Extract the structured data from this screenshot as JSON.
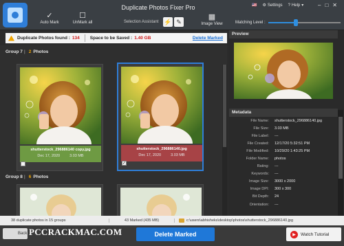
{
  "app": {
    "title": "Duplicate Photos Fixer Pro"
  },
  "toolbar": {
    "auto_mark": "Auto Mark",
    "unmark_all": "UnMark all",
    "selection_assistant": "Selection Assistant",
    "image_view": "Image View",
    "matching_level": "Matching Level :",
    "matching_value": 0.38
  },
  "top_links": {
    "flag": "🇺🇸",
    "settings": "Settings",
    "help": "Help"
  },
  "window_controls": {
    "minimize": "–",
    "maximize": "□",
    "close": "✕"
  },
  "banner": {
    "found_label": "Duplicate Photos found :",
    "found_value": "134",
    "saved_label": "Space to be Saved :",
    "saved_value": "1.40 GB",
    "delete_link": "Delete Marked"
  },
  "groups": [
    {
      "label": "Group 7",
      "count": "2",
      "suffix": "Photos",
      "items": [
        {
          "name": "shutterstock_296886140 copy.jpg",
          "date": "Dec 17, 2020",
          "size": "3.03 MB",
          "checked": false,
          "status": "kept"
        },
        {
          "name": "shutterstock_296886140.jpg",
          "date": "Dec 17, 2020",
          "size": "3.03 MB",
          "checked": true,
          "status": "marked"
        }
      ]
    },
    {
      "label": "Group 8",
      "count": "6",
      "suffix": "Photos"
    }
  ],
  "preview": {
    "title": "Preview"
  },
  "metadata": {
    "title": "Metadata",
    "rows": [
      {
        "k": "File Name:",
        "v": "shutterstock_296886140.jpg"
      },
      {
        "k": "File Size:",
        "v": "3.03 MB"
      },
      {
        "k": "File Label:",
        "v": "---"
      },
      {
        "k": "File Created:",
        "v": "12/17/20 5:32:51 PM"
      },
      {
        "k": "File Modified:",
        "v": "10/29/20 1:43:25 PM"
      },
      {
        "k": "Folder Name:",
        "v": "photos"
      },
      {
        "k": "Rating:",
        "v": "---"
      },
      {
        "k": "Keywords:",
        "v": "---"
      },
      {
        "k": "Image Size:",
        "v": "3000 x 2000"
      },
      {
        "k": "Image DPI:",
        "v": "300 x 300"
      },
      {
        "k": "Bit Depth:",
        "v": "24"
      },
      {
        "k": "Orientation:",
        "v": "---"
      }
    ]
  },
  "status": {
    "groups_info": "38 duplicate photos in 15 groups",
    "marked_info": "43 Marked (435 MB)",
    "path": "c:\\users\\abhisheks\\desktop\\photos\\shutterstock_296886140.jpg"
  },
  "bottom": {
    "back": "Back",
    "delete_marked": "Delete Marked",
    "watch_tutorial": "Watch Tutorial",
    "watermark": "PCCRACKMAC.COM"
  },
  "colors": {
    "accent": "#1f78d8",
    "kept": "#6e9a43",
    "marked": "#a74346",
    "highlight": "#f0a400"
  }
}
